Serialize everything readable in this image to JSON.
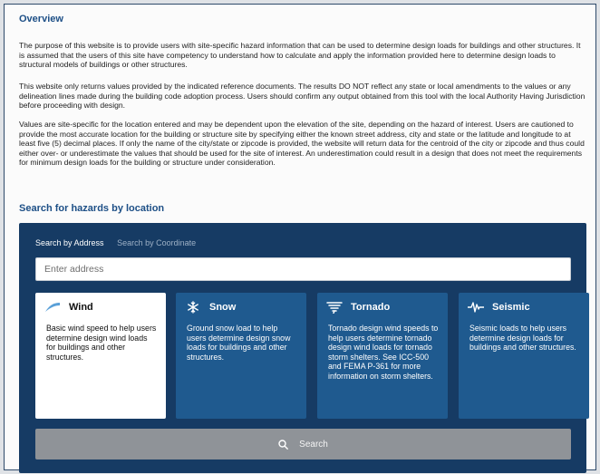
{
  "overview": {
    "title": "Overview",
    "paragraphs": [
      "The purpose of this website is to provide users with site-specific hazard information that can be used to determine design loads for buildings and other structures. It is assumed that the users of this site have competency to understand how to calculate and apply the information provided here to determine design loads to structural models of buildings or other structures.",
      "This website only returns values provided by the indicated reference documents. The results DO NOT reflect any state or local amendments to the values or any delineation lines made during the building code adoption process. Users should confirm any output obtained from this tool with the local Authority Having Jurisdiction before proceeding with design.",
      "Values are site-specific for the location entered and may be dependent upon the elevation of the site, depending on the hazard of interest. Users are cautioned to provide the most accurate location for the building or structure site by specifying either the known street address, city and state or the latitude and longitude to at least five (5) decimal places. If only the name of the city/state or zipcode is provided, the website will return data for the centroid of the city or zipcode and thus could either over- or underestimate the values that should be used for the site of interest. An underestimation could result in a design that does not meet the requirements for minimum design loads for the building or structure under consideration."
    ]
  },
  "search": {
    "title": "Search for hazards by location",
    "tabs": [
      "Search by Address",
      "Search by Coordinate"
    ],
    "address_placeholder": "Enter address",
    "button_label": "Search",
    "button_icon": "search-icon"
  },
  "hazards": [
    {
      "name": "Wind",
      "icon": "wind-icon",
      "selected": true,
      "description": "Basic wind speed to help users determine design wind loads for buildings and other structures."
    },
    {
      "name": "Snow",
      "icon": "snowflake-icon",
      "selected": false,
      "description": "Ground snow load to help users determine design snow loads for buildings and other structures."
    },
    {
      "name": "Tornado",
      "icon": "tornado-icon",
      "selected": false,
      "description": "Tornado design wind speeds to help users determine tornado design wind loads for tornado storm shelters. See ICC-500 and FEMA P-361 for more information on storm shelters."
    },
    {
      "name": "Seismic",
      "icon": "seismic-icon",
      "selected": false,
      "description": "Seismic loads to help users determine design loads for buildings and other structures."
    }
  ],
  "colors": {
    "heading": "#1d4f86",
    "panel": "#163b64",
    "card": "#1f5a8f",
    "wind_icon": "#5aa0d8",
    "search_button": "#8f9398"
  }
}
